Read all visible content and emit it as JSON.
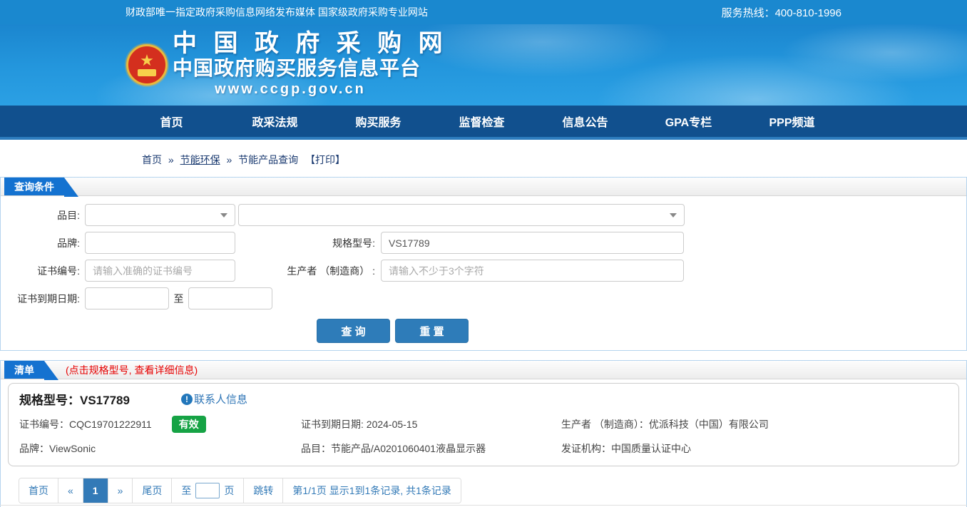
{
  "topbar": {
    "slogan": "财政部唯一指定政府采购信息网络发布媒体 国家级政府采购专业网站",
    "hotline_label": "服务热线：",
    "hotline_number": "400-810-1996"
  },
  "banner": {
    "site_title": "中 国 政 府 采 购 网",
    "site_subtitle": "中国政府购买服务信息平台",
    "site_url": "www.ccgp.gov.cn",
    "logo": "national-emblem"
  },
  "nav": {
    "items": [
      {
        "label": "首页"
      },
      {
        "label": "政采法规"
      },
      {
        "label": "购买服务"
      },
      {
        "label": "监督检查"
      },
      {
        "label": "信息公告"
      },
      {
        "label": "GPA专栏"
      },
      {
        "label": "PPP频道"
      }
    ]
  },
  "breadcrumb": {
    "home": "首页",
    "sep1": "»",
    "section": "节能环保",
    "sep2": "»",
    "current": "节能产品查询",
    "print": "【打印】"
  },
  "query_panel": {
    "title": "查询条件",
    "fields": {
      "category_label": "品目:",
      "brand_label": "品牌:",
      "model_label": "规格型号:",
      "model_value": "VS17789",
      "cert_no_label": "证书编号:",
      "cert_no_placeholder": "请输入准确的证书编号",
      "manufacturer_label": "生产者 （制造商） :",
      "manufacturer_placeholder": "请输入不少于3个字符",
      "cert_expiry_label": "证书到期日期:",
      "to_label": "至"
    },
    "buttons": {
      "search": "查 询",
      "reset": "重 置"
    }
  },
  "list_panel": {
    "title": "清单",
    "note": "(点击规格型号, 查看详细信息)",
    "record": {
      "model_label": "规格型号：",
      "model_value": "VS17789",
      "contact_link": "联系人信息",
      "info_icon": "!",
      "cert_no_label": "证书编号：",
      "cert_no_value": "CQC19701222911",
      "status_badge": "有效",
      "expiry_label": "证书到期日期: ",
      "expiry_value": "2024-05-15",
      "manufacturer_label": "生产者 （制造商）：",
      "manufacturer_value": "优派科技（中国）有限公司",
      "brand_label": "品牌：",
      "brand_value": "ViewSonic",
      "category_label": "品目：",
      "category_value": "节能产品/A0201060401液晶显示器",
      "issuer_label": "发证机构：",
      "issuer_value": "中国质量认证中心"
    }
  },
  "pagination": {
    "first": "首页",
    "prev": "«",
    "page": "1",
    "next": "»",
    "last": "尾页",
    "goto_prefix": "至",
    "goto_suffix": "页",
    "jump": "跳转",
    "summary": "第1/1页 显示1到1条记录, 共1条记录"
  },
  "colors": {
    "topbar_blue": "#1a88cf",
    "banner_blue": "#2497dd",
    "nav_blue": "#11508e",
    "tab_blue": "#1472d0",
    "button_blue": "#2e7cb9",
    "badge_green": "#16a345",
    "link_blue": "#2e75b6",
    "note_red": "#e60000",
    "pagination_blue": "#337ab7",
    "breadcrumb_navy": "#1a3a70"
  }
}
